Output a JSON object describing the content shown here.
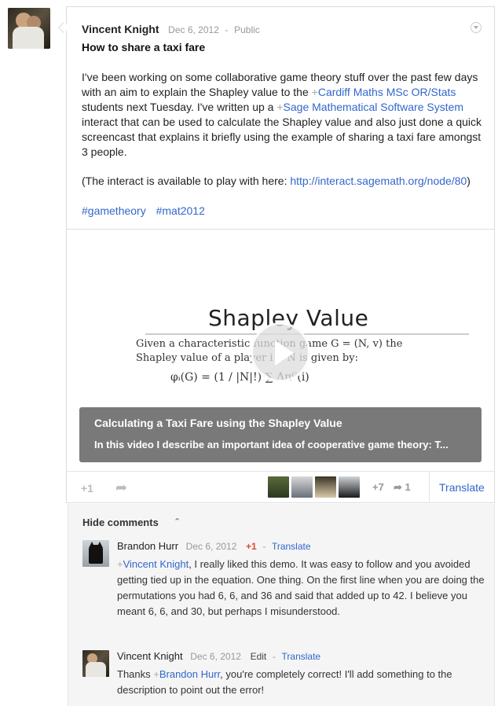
{
  "post": {
    "author": "Vincent Knight",
    "date": "Dec 6, 2012",
    "visibility": "Public",
    "title": "How to share a taxi fare",
    "body_1": "I've been working on some collaborative game theory stuff over the past few days with an aim to explain the Shapley value to the ",
    "mention_1_plus": "+",
    "mention_1": "Cardiff Maths MSc OR/Stats",
    "body_2": " students next Tuesday. I've written up a ",
    "mention_2_plus": "+",
    "mention_2": "Sage Mathematical Software System",
    "body_3": " interact that can be used to calculate the Shapley value and also just done a quick screencast that explains it briefly using the example of sharing a taxi fare amongst 3 people.",
    "interact_text": "(The interact is available to play with here: ",
    "interact_link": "http://interact.sagemath.org/node/80",
    "interact_close": ")",
    "tags": [
      "#gametheory",
      "#mat2012"
    ]
  },
  "video": {
    "slide_title": "Shapley Value",
    "slide_line1": "Given a characteristic function game G = (N, v) the",
    "slide_line2": "Shapley value of a player i ∈ N is given by:",
    "slide_formula": "φᵢ(G) = (1 / |N|!) ∑ Δπᴳ(i)",
    "title": "Calculating a Taxi Fare using the Shapley Value",
    "description": "In this video I describe an important idea of cooperative game theory: T..."
  },
  "actions": {
    "plusone": "+1",
    "plus_count": "+7",
    "share_count": "1",
    "translate": "Translate"
  },
  "comments": {
    "hide_label": "Hide comments",
    "items": [
      {
        "author": "Brandon Hurr",
        "date": "Dec 6, 2012",
        "plusone": "+1",
        "dash": "-",
        "translate": "Translate",
        "mention_plus": "+",
        "mention": "Vincent Knight",
        "text": ", I really liked this demo. It was easy to follow and you avoided getting tied up in the equation. One thing. On the first line when you are doing the permutations you had 6, 6, and 36 and said that added up to 42. I believe you meant 6, 6, and 30, but perhaps I misunderstood."
      },
      {
        "author": "Vincent Knight",
        "date": "Dec 6, 2012",
        "edit": "Edit",
        "dash": "-",
        "translate": "Translate",
        "text_pre": "Thanks ",
        "mention_plus": "+",
        "mention": "Brandon Hurr",
        "text": ", you're completely correct! I'll add something to the description to point out the error!"
      }
    ]
  },
  "colors": {
    "link": "#3366cc",
    "plus_red": "#dd4b39"
  }
}
